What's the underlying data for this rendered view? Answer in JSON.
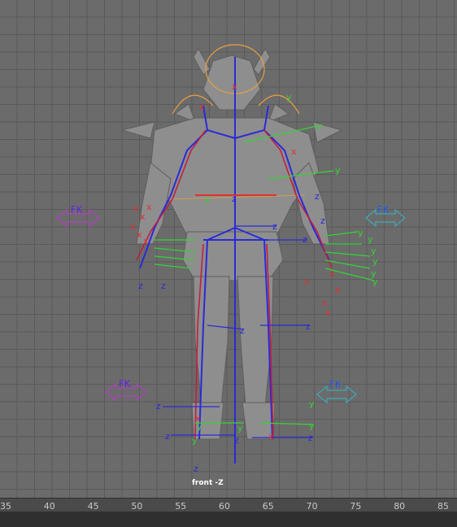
{
  "viewport": {
    "camera_label": "front -Z",
    "fk_labels": [
      "FK",
      "FK",
      "FK",
      "FK"
    ],
    "axis_labels": {
      "y": "y",
      "z": "z"
    }
  },
  "timeline": {
    "ticks": [
      "35",
      "40",
      "45",
      "50",
      "55",
      "60",
      "65",
      "70",
      "75",
      "80",
      "85"
    ]
  },
  "colors": {
    "grid": "#5a5a5a",
    "background": "#6b6b6b",
    "joint_red": "#e03030",
    "joint_blue": "#2a2ad8",
    "joint_green": "#35d335",
    "fk_purple": "#b040c0",
    "fk_teal": "#40a8b8",
    "halo_orange": "#e8a040"
  }
}
